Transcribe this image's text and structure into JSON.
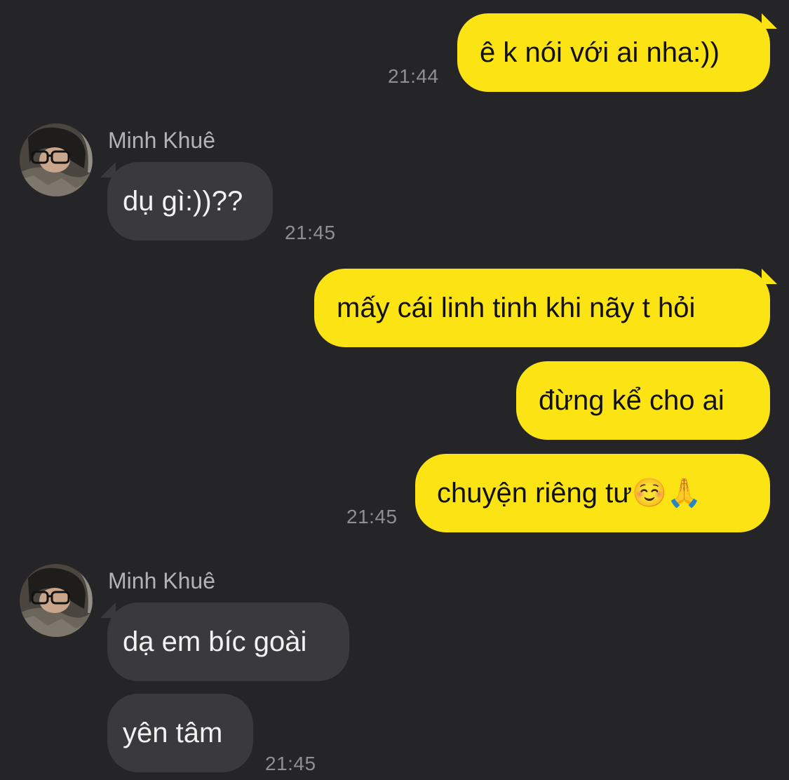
{
  "colors": {
    "background": "#252527",
    "outgoing_bubble": "#fbe314",
    "incoming_bubble": "#3a3a3c",
    "timestamp": "#8f8f93",
    "sender_name": "#b3b3b7"
  },
  "messages": [
    {
      "direction": "outgoing",
      "text": "ê k nói với ai nha:))",
      "time": "21:44"
    },
    {
      "direction": "incoming",
      "sender": "Minh Khuê",
      "avatar_icon": "user-avatar-photo",
      "text": "dụ gì:))??",
      "time": "21:45"
    },
    {
      "direction": "outgoing",
      "text": "mấy cái linh tinh khi nãy t hỏi"
    },
    {
      "direction": "outgoing",
      "text": "đừng kể cho ai"
    },
    {
      "direction": "outgoing",
      "text": "chuyện riêng tư☺️🙏",
      "time": "21:45"
    },
    {
      "direction": "incoming",
      "sender": "Minh Khuê",
      "avatar_icon": "user-avatar-photo",
      "text": "dạ em bíc goài"
    },
    {
      "direction": "incoming",
      "text": "yên tâm",
      "time": "21:45"
    }
  ]
}
